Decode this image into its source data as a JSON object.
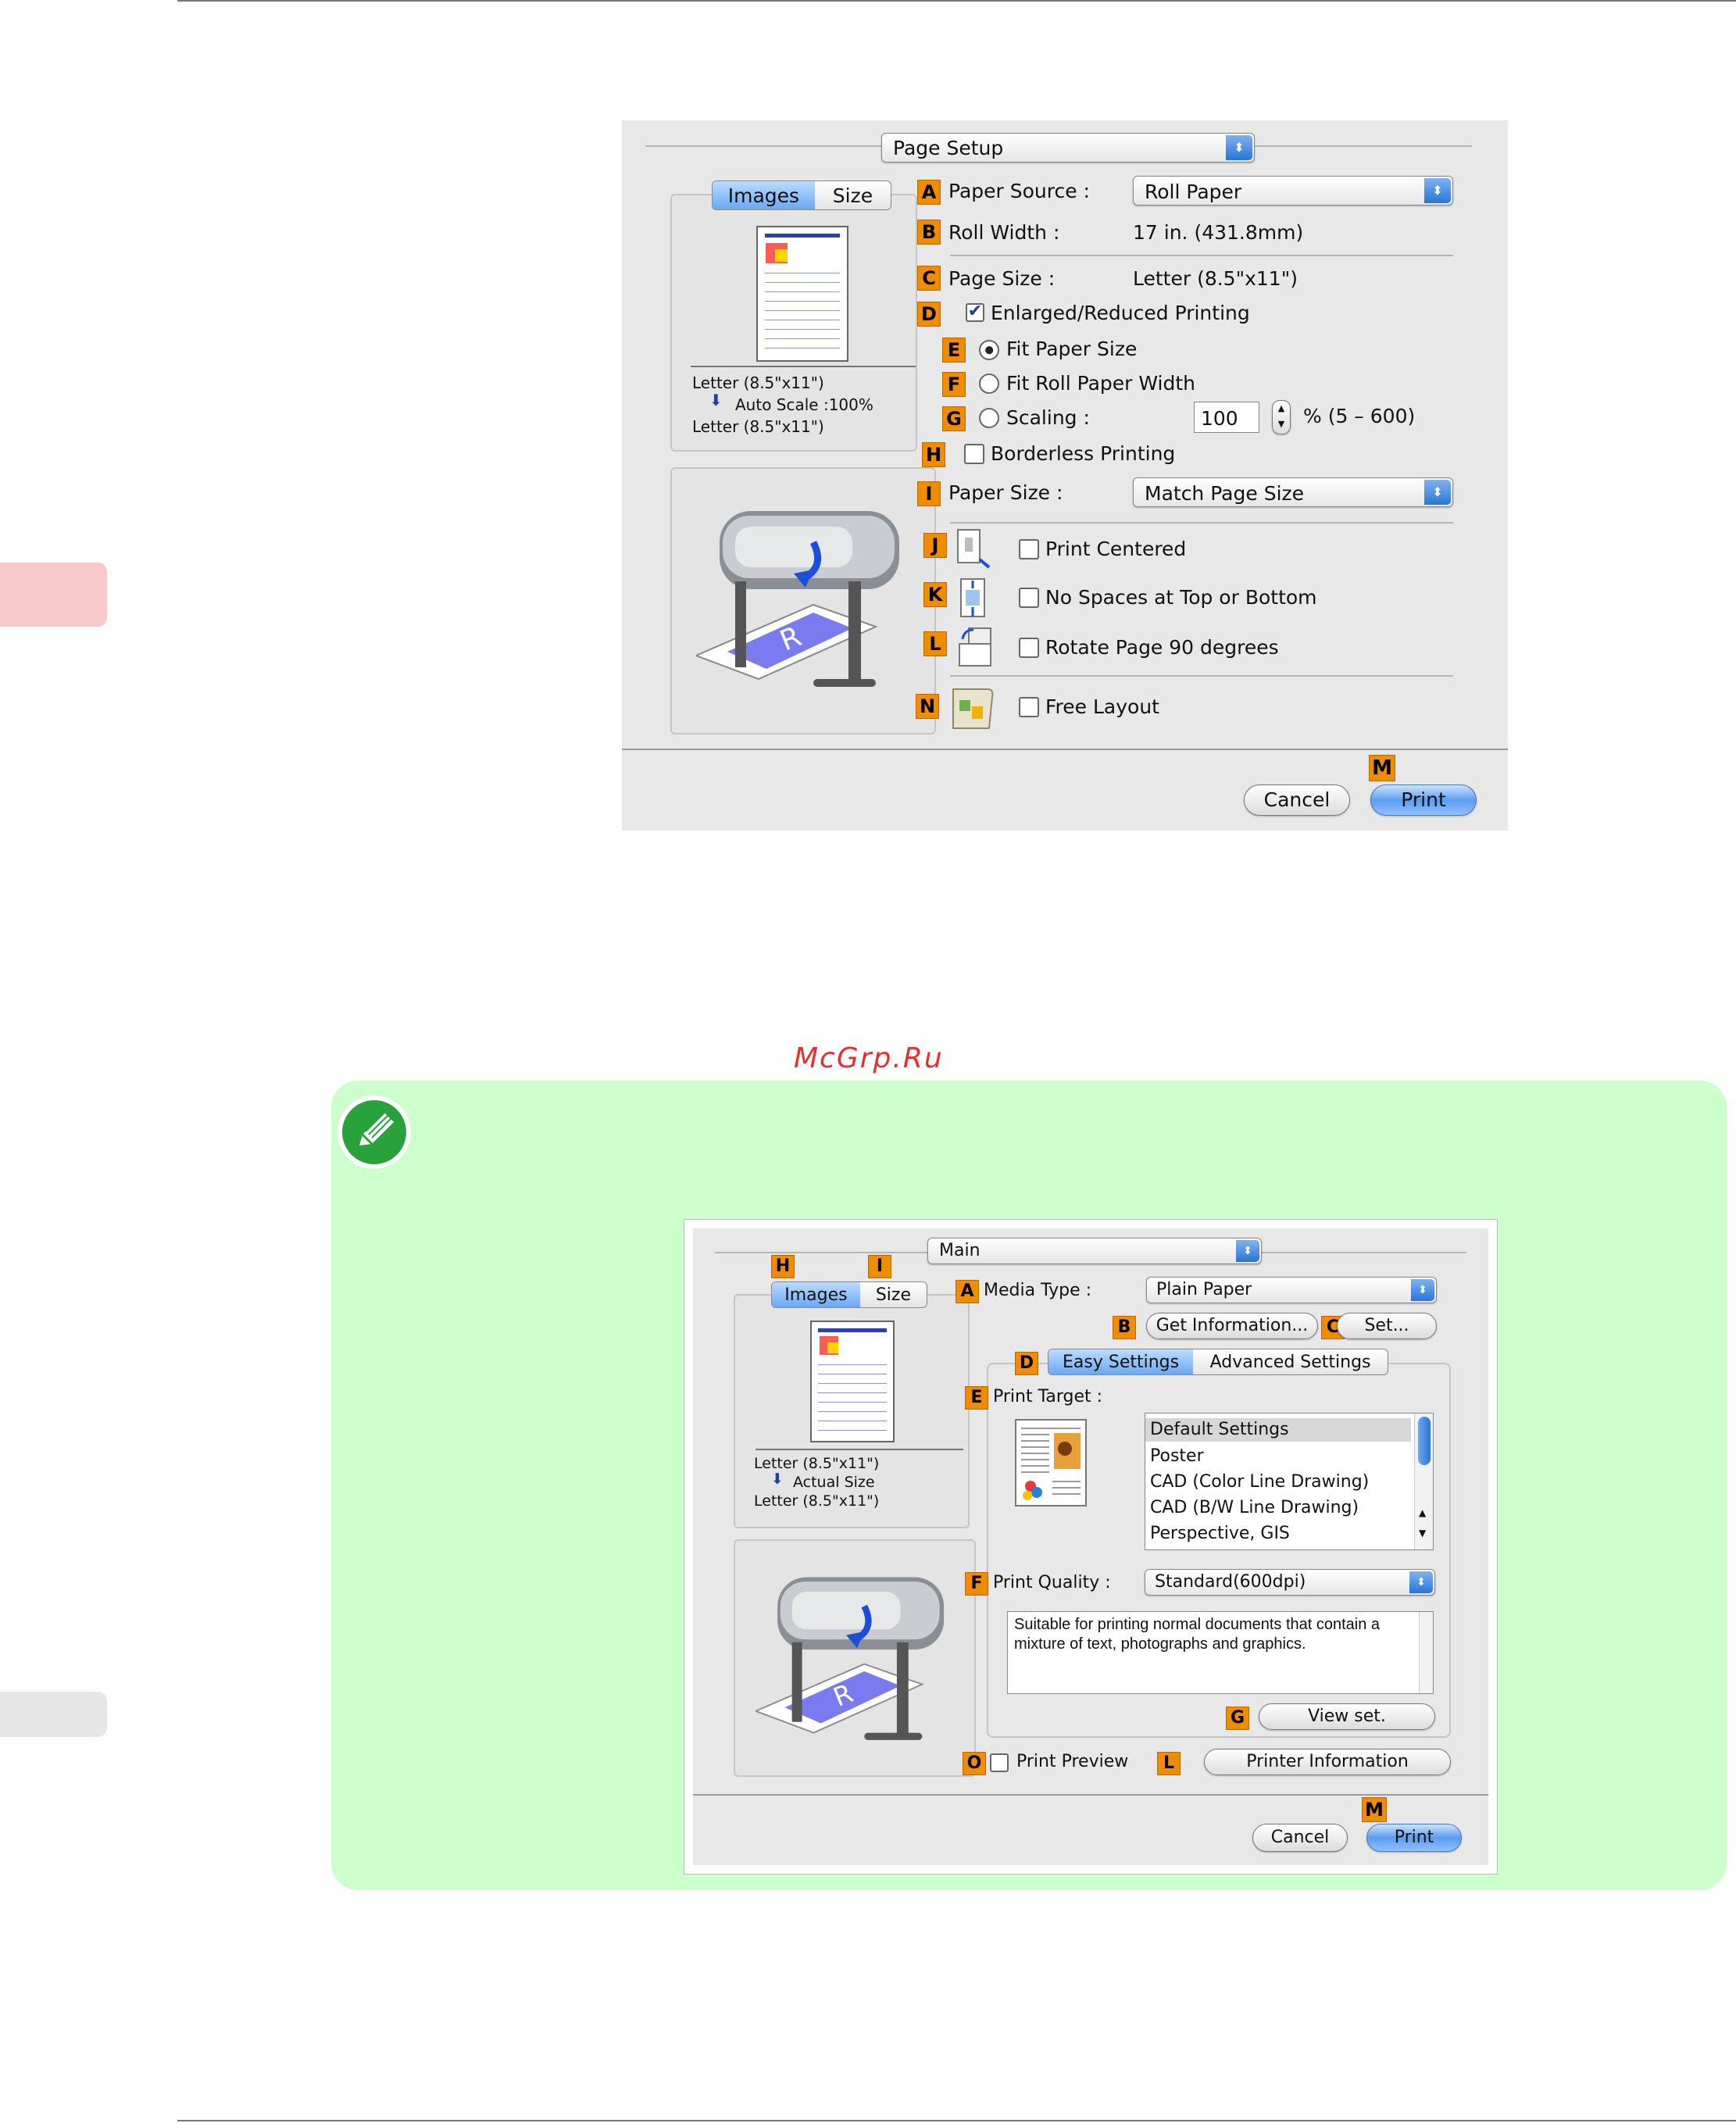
{
  "watermark": "McGrp.Ru",
  "page_setup_dialog": {
    "title_popup": "Page Setup",
    "tabs": [
      "Images",
      "Size"
    ],
    "preview_caption": [
      "Letter (8.5\"x11\")",
      "Auto Scale :100%",
      "Letter (8.5\"x11\")"
    ],
    "paper_source_label": "Paper Source :",
    "paper_source_value": "Roll Paper",
    "roll_width_label": "Roll Width :",
    "roll_width_value": "17 in. (431.8mm)",
    "page_size_label": "Page Size :",
    "page_size_value": "Letter (8.5\"x11\")",
    "enlarged_label": "Enlarged/Reduced Printing",
    "fit_paper_label": "Fit Paper Size",
    "fit_roll_label": "Fit Roll Paper Width",
    "scaling_label": "Scaling :",
    "scaling_value": "100",
    "scaling_range": "% (5 – 600)",
    "borderless_label": "Borderless Printing",
    "paper_size_label": "Paper Size :",
    "paper_size_value": "Match Page Size",
    "print_centered_label": "Print Centered",
    "no_spaces_label": "No Spaces at Top or Bottom",
    "rotate_label": "Rotate Page 90 degrees",
    "free_layout_label": "Free Layout",
    "cancel_label": "Cancel",
    "print_label": "Print",
    "callouts": {
      "a": "A",
      "b": "B",
      "c": "C",
      "d": "D",
      "e": "E",
      "f": "F",
      "g": "G",
      "h": "H",
      "i": "I",
      "j": "J",
      "k": "K",
      "l": "L",
      "m": "M",
      "n": "N"
    }
  },
  "main_dialog": {
    "title_popup": "Main",
    "tabs": [
      "Images",
      "Size"
    ],
    "preview_caption": [
      "Letter (8.5\"x11\")",
      "Actual Size",
      "Letter (8.5\"x11\")"
    ],
    "media_type_label": "Media Type :",
    "media_type_value": "Plain Paper",
    "get_info_label": "Get Information...",
    "set_label": "Set...",
    "settings_tabs": [
      "Easy Settings",
      "Advanced Settings"
    ],
    "print_target_label": "Print Target :",
    "print_target_items": [
      "Default Settings",
      "Poster",
      "CAD (Color Line Drawing)",
      "CAD (B/W Line Drawing)",
      "Perspective, GIS"
    ],
    "print_quality_label": "Print Quality :",
    "print_quality_value": "Standard(600dpi)",
    "description": "Suitable for printing normal documents that contain a mixture of text, photographs and graphics.",
    "view_set_label": "View set.",
    "print_preview_label": "Print Preview",
    "printer_info_label": "Printer Information",
    "cancel_label": "Cancel",
    "print_label": "Print",
    "callouts": {
      "h": "H",
      "i": "I",
      "a": "A",
      "b": "B",
      "c": "C",
      "d": "D",
      "e": "E",
      "f": "F",
      "g": "G",
      "o": "O",
      "l": "L",
      "m": "M"
    }
  },
  "colors": {
    "note_background": "#ccffcc",
    "callout": "#f08c00",
    "side_tab_red": "#f7c9c9",
    "side_tab_gray": "#e6e6e6"
  },
  "icons": [
    "pencil-note-icon",
    "printer-illustration",
    "print-centered-icon",
    "no-spaces-icon",
    "rotate-page-icon",
    "free-layout-icon",
    "page-thumbnail"
  ]
}
